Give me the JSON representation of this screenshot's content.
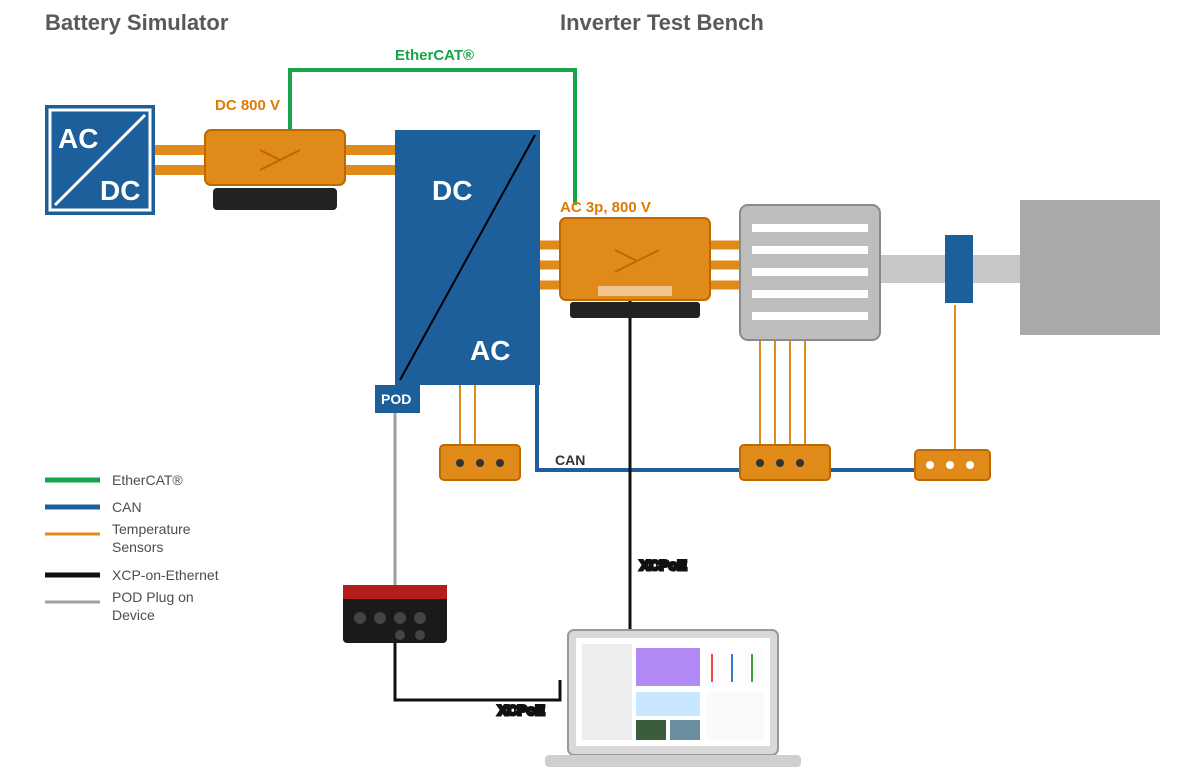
{
  "titles": {
    "left": "Battery Simulator",
    "right": "Inverter Test Bench"
  },
  "blocks": {
    "acdc_ac": "AC",
    "acdc_dc": "DC",
    "inv_dc": "DC",
    "inv_ac": "AC",
    "pod": "POD"
  },
  "labels": {
    "dc800": "DC 800 V",
    "ac3p": "AC 3p, 800 V",
    "ethercat": "EtherCAT®",
    "can": "CAN",
    "xcpoe": "XCPoE"
  },
  "legend": {
    "l1": "EtherCAT®",
    "l2": "CAN",
    "l3": "Temperature Sensors",
    "l4": "XCP-on-Ethernet",
    "l5": "POD Plug on Device"
  },
  "colors": {
    "blue": "#1c5f9b",
    "orange": "#e08a1a",
    "orangeDark": "#c06800",
    "green": "#17a34a",
    "grey": "#a9a9a9",
    "greyLight": "#c8c8c8",
    "legend": "#4d4d4d"
  }
}
